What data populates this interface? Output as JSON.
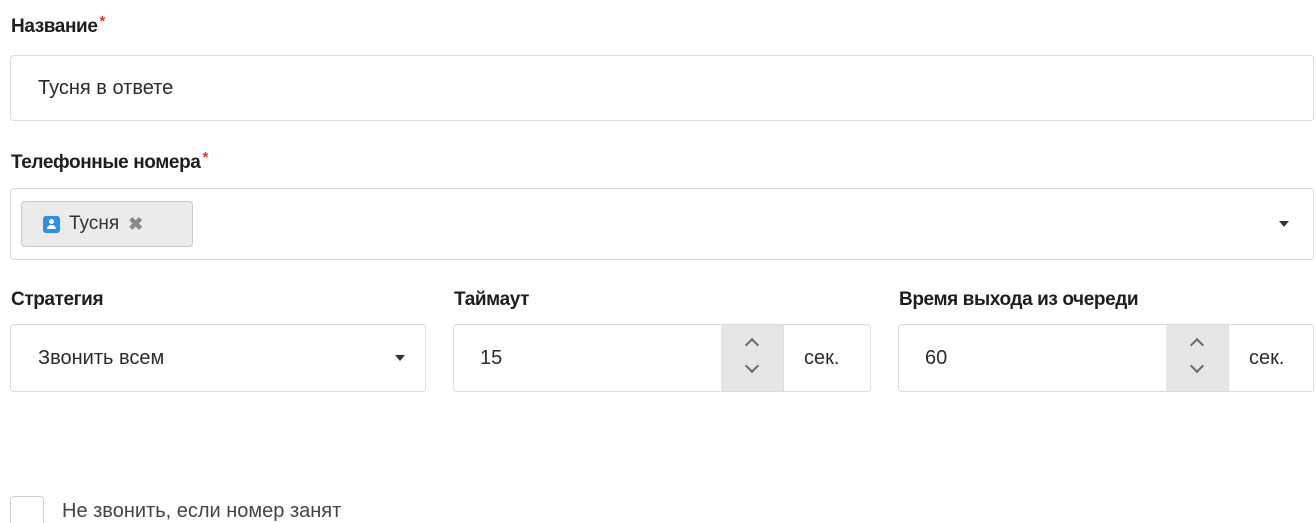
{
  "name_field": {
    "label": "Название",
    "required_mark": "*",
    "value": "Тусня в ответе"
  },
  "phones_field": {
    "label": "Телефонные номера",
    "required_mark": "*",
    "tags": [
      {
        "label": "Тусня",
        "icon": "contact-card-icon",
        "remove": "✖"
      }
    ]
  },
  "strategy_field": {
    "label": "Стратегия",
    "value": "Звонить всем"
  },
  "timeout_field": {
    "label": "Таймаут",
    "value": "15",
    "unit": "сек."
  },
  "queue_exit_field": {
    "label": "Время выхода из очереди",
    "value": "60",
    "unit": "сек."
  },
  "busy_checkbox": {
    "label": "Не звонить, если номер занят",
    "checked": false
  },
  "colors": {
    "required": "#e0342a",
    "tag_icon": "#2f8fe0",
    "spin_bg": "#e6e6e6",
    "border": "#dcdcdc"
  }
}
